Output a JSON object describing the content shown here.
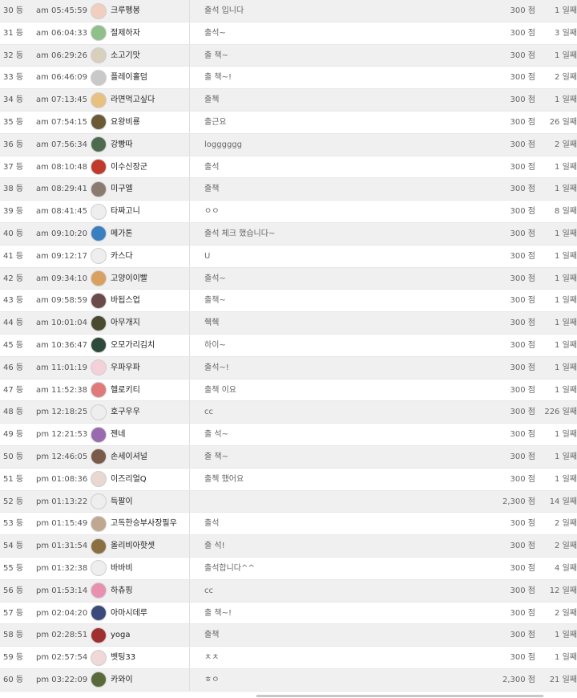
{
  "rows": [
    {
      "rank": "30 등",
      "time": "am 05:45:59",
      "nick": "크루펭봉",
      "comment": "출석 입니다",
      "points": "300 점",
      "days": "1 일째",
      "avatar": "#f1cfc0"
    },
    {
      "rank": "31 등",
      "time": "am 06:04:33",
      "nick": "절제하자",
      "comment": "출석~",
      "points": "300 점",
      "days": "3 일째",
      "avatar": "#8fc08a"
    },
    {
      "rank": "32 등",
      "time": "am 06:29:26",
      "nick": "소고기맛",
      "comment": "출 책~",
      "points": "300 점",
      "days": "1 일째",
      "avatar": "#d8d0bd"
    },
    {
      "rank": "33 등",
      "time": "am 06:46:09",
      "nick": "플레이홀덤",
      "comment": "출 책~!",
      "points": "300 점",
      "days": "2 일째",
      "avatar": "#c9c9c9"
    },
    {
      "rank": "34 등",
      "time": "am 07:13:45",
      "nick": "라면먹고싶다",
      "comment": "출첵",
      "points": "300 점",
      "days": "1 일째",
      "avatar": "#e8c080"
    },
    {
      "rank": "35 등",
      "time": "am 07:54:15",
      "nick": "요왕비룡",
      "comment": "출근요",
      "points": "300 점",
      "days": "26 일째",
      "avatar": "#6b5a35"
    },
    {
      "rank": "36 등",
      "time": "am 07:56:34",
      "nick": "강빵따",
      "comment": "logggggg",
      "points": "300 점",
      "days": "2 일째",
      "avatar": "#4e6b4e"
    },
    {
      "rank": "37 등",
      "time": "am 08:10:48",
      "nick": "이수신장군",
      "comment": "출석",
      "points": "300 점",
      "days": "1 일째",
      "avatar": "#c0392b"
    },
    {
      "rank": "38 등",
      "time": "am 08:29:41",
      "nick": "미구엘",
      "comment": "출책",
      "points": "300 점",
      "days": "1 일째",
      "avatar": "#8a7a70"
    },
    {
      "rank": "39 등",
      "time": "am 08:41:45",
      "nick": "타짜고니",
      "comment": "ㅇㅇ",
      "points": "300 점",
      "days": "8 일째",
      "avatar": "#eeeeee"
    },
    {
      "rank": "40 등",
      "time": "am 09:10:20",
      "nick": "메가톤",
      "comment": "출석 체크 했습니다~",
      "points": "300 점",
      "days": "1 일째",
      "avatar": "#3a7fc0"
    },
    {
      "rank": "41 등",
      "time": "am 09:12:17",
      "nick": "카스다",
      "comment": "U",
      "points": "300 점",
      "days": "1 일째",
      "avatar": "#eeeeee"
    },
    {
      "rank": "42 등",
      "time": "am 09:34:10",
      "nick": "고양이이빨",
      "comment": "출석~",
      "points": "300 점",
      "days": "1 일째",
      "avatar": "#d9a060"
    },
    {
      "rank": "43 등",
      "time": "am 09:58:59",
      "nick": "바됩스업",
      "comment": "출책~",
      "points": "300 점",
      "days": "1 일째",
      "avatar": "#6a4a4a"
    },
    {
      "rank": "44 등",
      "time": "am 10:01:04",
      "nick": "아무개지",
      "comment": "췍췍",
      "points": "300 점",
      "days": "1 일째",
      "avatar": "#4a4a30"
    },
    {
      "rank": "45 등",
      "time": "am 10:36:47",
      "nick": "오모가리김치",
      "comment": "하이~",
      "points": "300 점",
      "days": "1 일째",
      "avatar": "#2e4a3a"
    },
    {
      "rank": "46 등",
      "time": "am 11:01:19",
      "nick": "우파우파",
      "comment": "출석~!",
      "points": "300 점",
      "days": "1 일째",
      "avatar": "#f4d0d8"
    },
    {
      "rank": "47 등",
      "time": "am 11:52:38",
      "nick": "헬로키티",
      "comment": "출책 이요",
      "points": "300 점",
      "days": "1 일째",
      "avatar": "#e07a7a"
    },
    {
      "rank": "48 등",
      "time": "pm 12:18:25",
      "nick": "호구우우",
      "comment": "cc",
      "points": "300 점",
      "days": "226 일째",
      "avatar": "#eeeeee"
    },
    {
      "rank": "49 등",
      "time": "pm 12:21:53",
      "nick": "젠네",
      "comment": "출 석~",
      "points": "300 점",
      "days": "1 일째",
      "avatar": "#9a6ab0"
    },
    {
      "rank": "50 등",
      "time": "pm 12:46:05",
      "nick": "손세이셔널",
      "comment": "출 책~",
      "points": "300 점",
      "days": "1 일째",
      "avatar": "#7a5a4a"
    },
    {
      "rank": "51 등",
      "time": "pm 01:08:36",
      "nick": "이즈리얼Q",
      "comment": "출첵 했어요",
      "points": "300 점",
      "days": "1 일째",
      "avatar": "#e8d8d0"
    },
    {
      "rank": "52 등",
      "time": "pm 01:13:22",
      "nick": "득팔이",
      "comment": "",
      "points": "2,300 점",
      "days": "14 일째",
      "avatar": "#eeeeee"
    },
    {
      "rank": "53 등",
      "time": "pm 01:15:49",
      "nick": "고독한승부사장필우",
      "comment": "출석",
      "points": "300 점",
      "days": "2 일째",
      "avatar": "#c0a890"
    },
    {
      "rank": "54 등",
      "time": "pm 01:31:54",
      "nick": "올리비아핫셋",
      "comment": "출 석!",
      "points": "300 점",
      "days": "2 일째",
      "avatar": "#8a7040"
    },
    {
      "rank": "55 등",
      "time": "pm 01:32:38",
      "nick": "바바비",
      "comment": "출석합니다^^",
      "points": "300 점",
      "days": "4 일째",
      "avatar": "#eeeeee"
    },
    {
      "rank": "56 등",
      "time": "pm 01:53:14",
      "nick": "하츄핑",
      "comment": "cc",
      "points": "300 점",
      "days": "12 일째",
      "avatar": "#e890b0"
    },
    {
      "rank": "57 등",
      "time": "pm 02:04:20",
      "nick": "아마시데루",
      "comment": "출 책~!",
      "points": "300 점",
      "days": "2 일째",
      "avatar": "#3a4a7a"
    },
    {
      "rank": "58 등",
      "time": "pm 02:28:51",
      "nick": "yoga",
      "comment": "출책",
      "points": "300 점",
      "days": "1 일째",
      "avatar": "#a03030"
    },
    {
      "rank": "59 등",
      "time": "pm 02:57:54",
      "nick": "벳팅33",
      "comment": "ㅊㅊ",
      "points": "300 점",
      "days": "1 일째",
      "avatar": "#f0d8d8"
    },
    {
      "rank": "60 등",
      "time": "pm 03:22:09",
      "nick": "카와이",
      "comment": "ㅎㅇ",
      "points": "2,300 점",
      "days": "21 일째",
      "avatar": "#5a6a3a"
    }
  ]
}
